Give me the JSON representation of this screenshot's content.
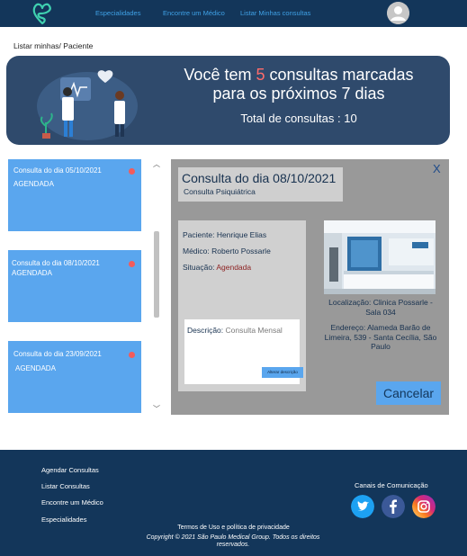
{
  "nav": {
    "links": [
      "Especialidades",
      "Encontre um Médico",
      "Listar Minhas consultas"
    ]
  },
  "breadcrumb": "Listar minhas/ Paciente",
  "banner": {
    "line1_prefix": "Você tem ",
    "count": "5",
    "line1_suffix": " consultas marcadas",
    "line2": "para os próximos 7 dias",
    "total": "Total de consultas : 10"
  },
  "appointments": [
    {
      "title": "Consulta do dia 05/10/2021",
      "status": "AGENDADA"
    },
    {
      "title": "Consulta do dia 08/10/2021",
      "status": "AGENDADA"
    },
    {
      "title": "Consulta do dia 23/09/2021",
      "status": "AGENDADA"
    }
  ],
  "detail": {
    "title": "Consulta do dia 08/10/2021",
    "subtitle": "Consulta Psiquiátrica",
    "close": "X",
    "patient_label": "Paciente: ",
    "patient": "Henrique Elias",
    "doctor_label": "Médico: ",
    "doctor": "Roberto Possarle",
    "status_label": "Situação: ",
    "status": "Agendada",
    "description_label": "Descrição: ",
    "description": "Consulta Mensal",
    "edit_description": "Alterar descrição",
    "location": "Localização: Clinica Possarle - Sala 034",
    "address": "Endereço: Alameda Barão de Limeira, 539 - Santa Cecília, São Paulo",
    "cancel": "Cancelar"
  },
  "footer": {
    "links": [
      "Agendar Consultas",
      "Listar Consultas",
      "Encontre um Médico",
      "Especialidades"
    ],
    "channels": "Canais de Comunicação",
    "terms": "Termos de Uso e política de privacidade",
    "copyright": "Copyright © 2021 São Paulo Medical Group. Todos os direitos reservados."
  },
  "colors": {
    "navy": "#13365a",
    "banner": "#2f4a6c",
    "accent_blue": "#5aa6ee",
    "highlight_red": "#ff6b6b",
    "panel_gray": "#999999"
  },
  "icons": [
    "logo-icon",
    "user-avatar-icon",
    "status-dot-icon",
    "twitter-icon",
    "facebook-icon",
    "instagram-icon"
  ]
}
